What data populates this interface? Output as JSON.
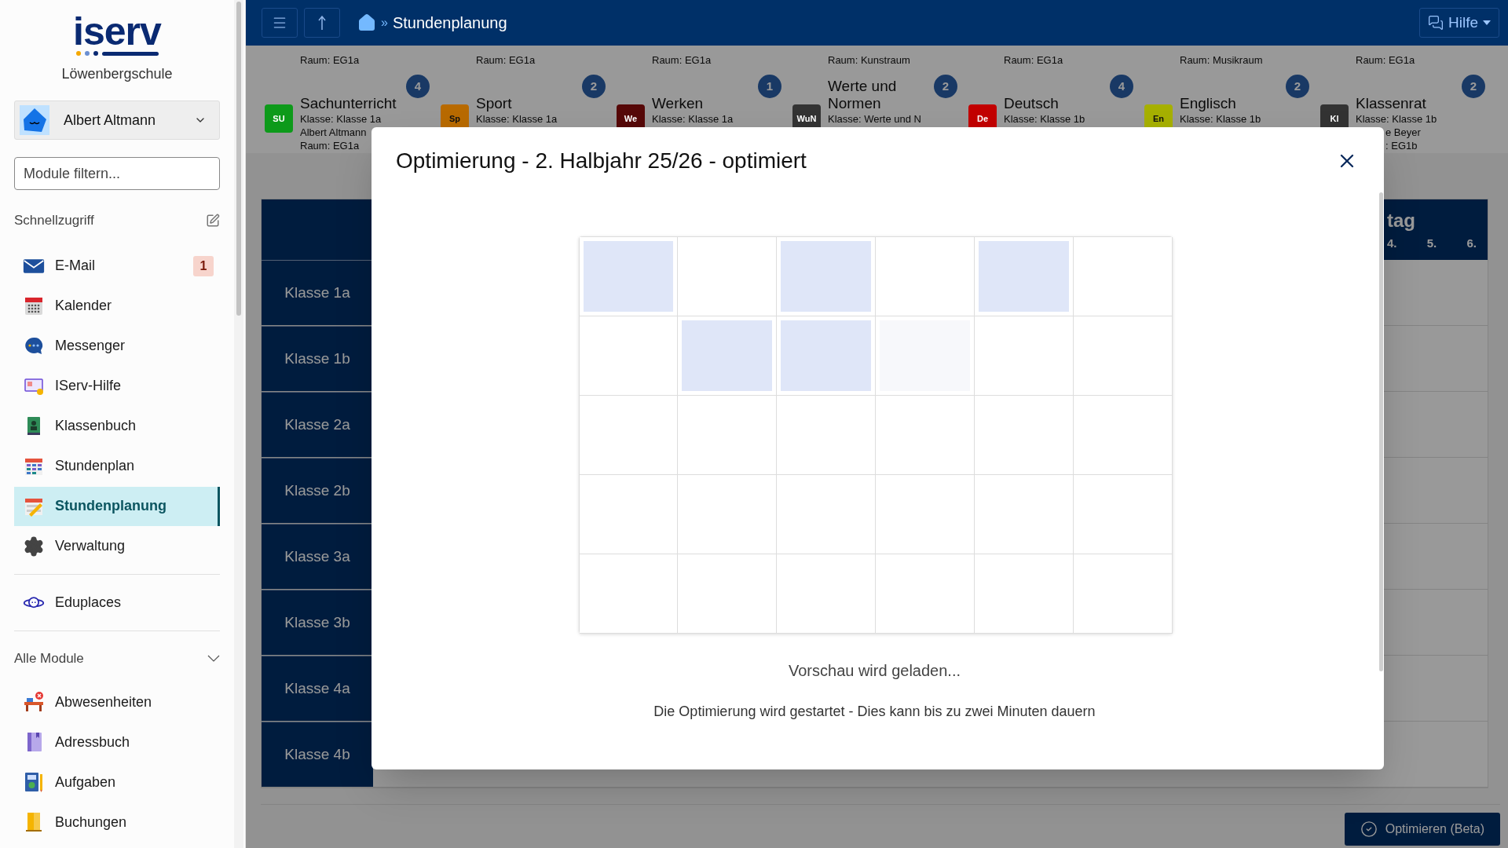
{
  "sidebar": {
    "logo": "iserv",
    "school": "Löwenbergschule",
    "user": {
      "name": "Albert Altmann"
    },
    "filter": {
      "placeholder": "Module filtern..."
    },
    "quick_access": {
      "title": "Schnellzugriff",
      "items": [
        {
          "label": "E-Mail",
          "selected": false,
          "badge": "1"
        },
        {
          "label": "Kalender",
          "selected": false
        },
        {
          "label": "Messenger",
          "selected": false
        },
        {
          "label": "IServ-Hilfe",
          "selected": false
        },
        {
          "label": "Klassenbuch",
          "selected": false
        },
        {
          "label": "Stundenplan",
          "selected": false
        },
        {
          "label": "Stundenplanung",
          "selected": true
        },
        {
          "label": "Verwaltung",
          "selected": false
        }
      ]
    },
    "external": [
      {
        "label": "Eduplaces",
        "selected": false
      }
    ],
    "all_modules": {
      "title": "Alle Module",
      "expanded": true,
      "items": [
        {
          "label": "Abwesenheiten",
          "selected": false
        },
        {
          "label": "Adressbuch",
          "selected": false
        },
        {
          "label": "Aufgaben",
          "selected": false
        },
        {
          "label": "Buchungen",
          "selected": false
        }
      ]
    }
  },
  "topbar": {
    "breadcrumb_separator": "»",
    "title": "Stundenplanung",
    "help": "Hilfe"
  },
  "previous_rooms": [
    "Raum: EG1a",
    "Raum: EG1a",
    "Raum: EG1a",
    "Raum: Kunstraum",
    "Raum: EG1a",
    "Raum: Musikraum",
    "Raum: EG1a"
  ],
  "lessons": [
    {
      "abbr": "SU",
      "color": "#0d9a1a",
      "title": "Sachunterricht",
      "count": "4",
      "lines": [
        "Klasse: Klasse 1a",
        "Albert Altmann",
        "Raum: EG1a"
      ]
    },
    {
      "abbr": "Sp",
      "color": "#b86a00",
      "title": "Sport",
      "count": "2",
      "lines": [
        "Klasse: Klasse 1a"
      ]
    },
    {
      "abbr": "We",
      "color": "#560808",
      "title": "Werken",
      "count": "1",
      "lines": [
        "Klasse: Klasse 1a"
      ]
    },
    {
      "abbr": "WuN",
      "color": "#333333",
      "title": "Werte und Normen",
      "count": "2",
      "lines": [
        "Klasse: Werte und N"
      ]
    },
    {
      "abbr": "De",
      "color": "#c20000",
      "title": "Deutsch",
      "count": "4",
      "lines": [
        "Klasse: Klasse 1b"
      ]
    },
    {
      "abbr": "En",
      "color": "#a6b000",
      "title": "Englisch",
      "count": "2",
      "lines": [
        "Klasse: Klasse 1b"
      ]
    },
    {
      "abbr": "Kl",
      "color": "#333333",
      "title": "Klassenrat",
      "count": "2",
      "lines": [
        "Klasse: Klasse 1b"
      ],
      "cut_lines": [
        "e Beyer",
        ": EG1b"
      ]
    }
  ],
  "timetable": {
    "day_header": "tag",
    "periods": [
      "4.",
      "5.",
      "6."
    ],
    "classes": [
      "Klasse 1a",
      "Klasse 1b",
      "Klasse 2a",
      "Klasse 2b",
      "Klasse 3a",
      "Klasse 3b",
      "Klasse 4a",
      "Klasse 4b"
    ]
  },
  "optimize_button": "Optimieren (Beta)",
  "modal": {
    "title": "Optimierung - 2. Halbjahr 25/26 - optimiert",
    "preview_grid": [
      [
        {
          "kind": "filled"
        },
        {
          "kind": "empty"
        },
        {
          "kind": "filled"
        },
        {
          "kind": "empty"
        },
        {
          "kind": "filled"
        },
        {
          "kind": "empty"
        }
      ],
      [
        {
          "kind": "empty"
        },
        {
          "kind": "filled"
        },
        {
          "kind": "filled"
        },
        {
          "kind": "faint"
        },
        {
          "kind": "empty"
        },
        {
          "kind": "empty"
        }
      ],
      [
        {
          "kind": "empty"
        },
        {
          "kind": "empty"
        },
        {
          "kind": "empty"
        },
        {
          "kind": "empty"
        },
        {
          "kind": "empty"
        },
        {
          "kind": "empty"
        }
      ],
      [
        {
          "kind": "empty"
        },
        {
          "kind": "empty"
        },
        {
          "kind": "empty"
        },
        {
          "kind": "empty"
        },
        {
          "kind": "empty"
        },
        {
          "kind": "empty"
        }
      ],
      [
        {
          "kind": "empty"
        },
        {
          "kind": "empty"
        },
        {
          "kind": "empty"
        },
        {
          "kind": "empty"
        },
        {
          "kind": "empty"
        },
        {
          "kind": "empty"
        }
      ]
    ],
    "status": "Vorschau wird geladen...",
    "message": "Die Optimierung wird gestartet - Dies kann bis zu zwei Minuten dauern"
  }
}
